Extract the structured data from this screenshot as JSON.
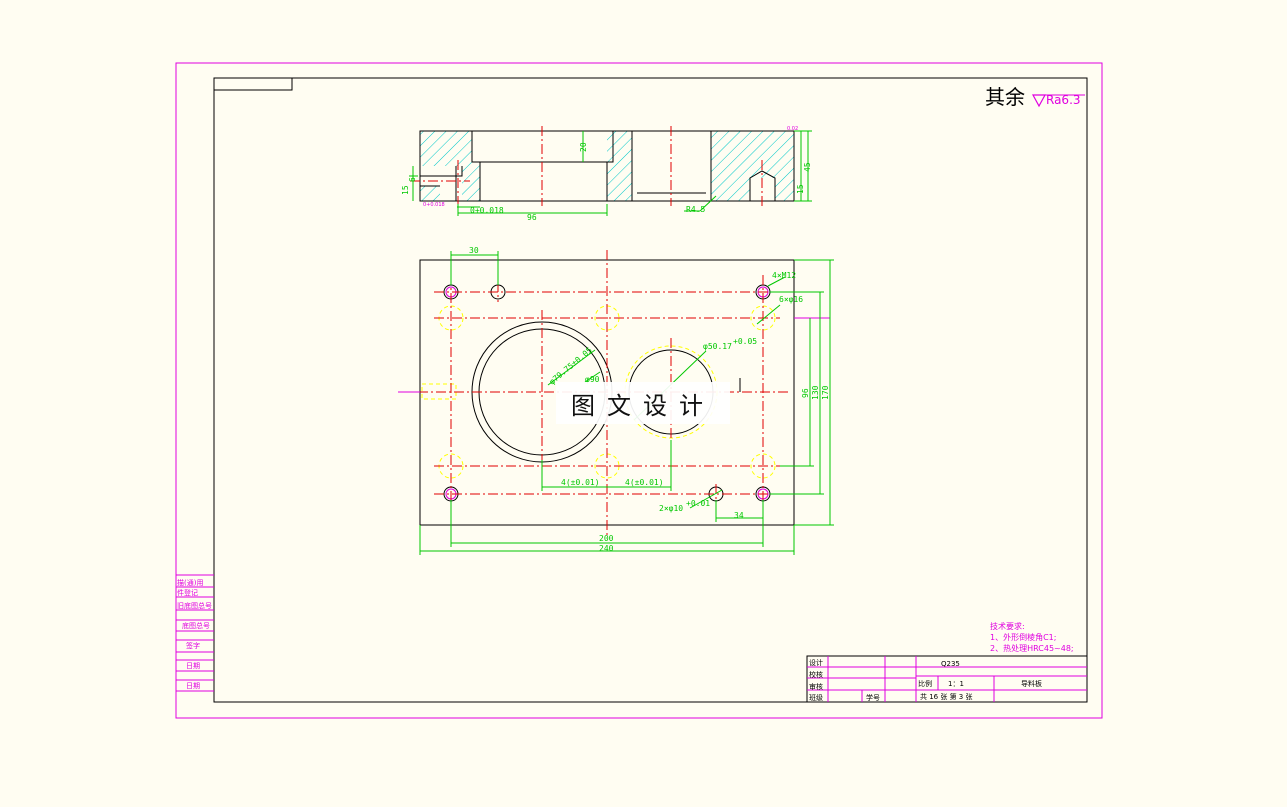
{
  "surface_note": {
    "prefix": "其余",
    "roughness": "Ra6.3"
  },
  "dims_section": {
    "d20": "20",
    "d45": "45",
    "d15r": "15",
    "d15l": "15",
    "d6": "6",
    "d96": "96",
    "r45": "R4.5",
    "phi6": "φ6",
    "tol018": "0+0.018",
    "tol_small": "0+0.018",
    "top_small": "0.02"
  },
  "dims_plan": {
    "d30": "30",
    "holes_m12": "4×M12",
    "holes_16": "6×φ16",
    "bore_5017": "φ50.17",
    "tol_05": "+0.05",
    "bore_79": "φ79.75±0.05",
    "bore_90": "φ90",
    "pos_left": "4(±0.01)",
    "pos_right": "4(±0.01)",
    "pins": "2×φ10",
    "pins_tol": "+0.01",
    "d34": "34",
    "d200": "200",
    "d240": "240",
    "d96": "96",
    "d130": "130",
    "d170": "170"
  },
  "watermark": "图文设计",
  "tech_req": {
    "title": "技术要求:",
    "line1": "1、外形倒棱角C1;",
    "line2": "2、热处理HRC45~48;"
  },
  "title_block": {
    "design": "设计",
    "check": "校核",
    "review": "审核",
    "class": "班级",
    "student_id": "学号",
    "material": "Q235",
    "scale_label": "比例",
    "scale_value": "1：1",
    "part_name": "导料板",
    "sheet": "共 16 张  第 3 张"
  },
  "side_labels": [
    "描(通)用",
    "件登记",
    "旧底图总号",
    "底图总号",
    "签字",
    "日期",
    "日期"
  ]
}
